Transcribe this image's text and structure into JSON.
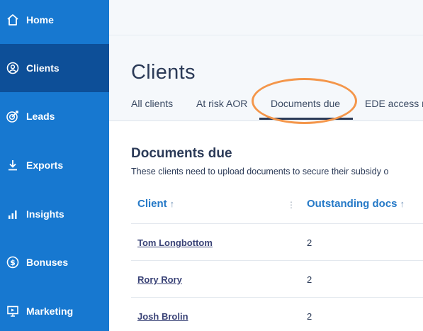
{
  "sidebar": {
    "items": [
      {
        "label": "Home",
        "icon": "home-icon"
      },
      {
        "label": "Clients",
        "icon": "user-icon",
        "active": true
      },
      {
        "label": "Leads",
        "icon": "target-icon"
      },
      {
        "label": "Exports",
        "icon": "download-icon"
      },
      {
        "label": "Insights",
        "icon": "bar-chart-icon"
      },
      {
        "label": "Bonuses",
        "icon": "dollar-icon"
      },
      {
        "label": "Marketing",
        "icon": "presentation-icon"
      }
    ]
  },
  "header": {
    "title": "Clients",
    "tabs": [
      {
        "label": "All clients"
      },
      {
        "label": "At risk AOR"
      },
      {
        "label": "Documents due",
        "active": true
      },
      {
        "label": "EDE access re"
      }
    ]
  },
  "section": {
    "title": "Documents due",
    "description": "These clients need to upload documents to secure their subsidy o"
  },
  "table": {
    "columns": [
      {
        "label": "Client",
        "sort": "↑"
      },
      {
        "label": "Outstanding docs",
        "sort": "↑"
      }
    ],
    "column_menu": "⋮",
    "rows": [
      {
        "client": "Tom Longbottom",
        "docs": "2"
      },
      {
        "client": "Rory Rory",
        "docs": "2"
      },
      {
        "client": "Josh Brolin",
        "docs": "2"
      }
    ]
  },
  "colors": {
    "sidebar": "#1778d0",
    "sidebar_active": "#0d4f98",
    "accent": "#2579c7",
    "highlight": "#f4964a"
  }
}
